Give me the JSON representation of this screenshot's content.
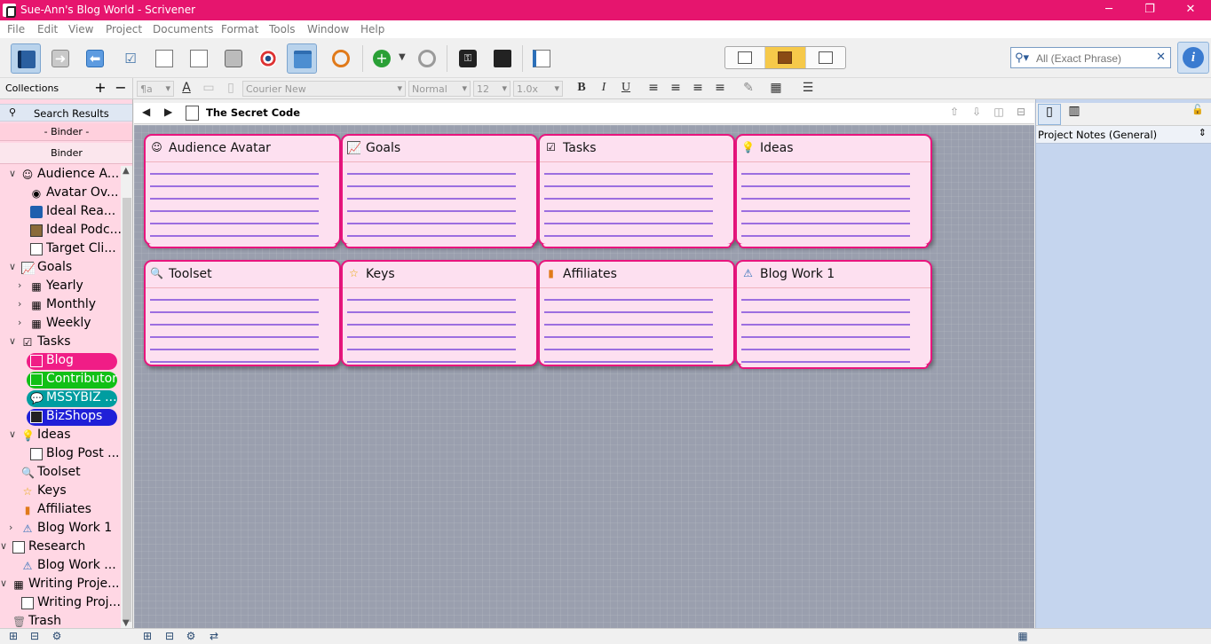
{
  "window": {
    "title": "Sue-Ann's Blog World - Scrivener",
    "minimize": "─",
    "restore": "❐",
    "close": "✕"
  },
  "menu": [
    "File",
    "Edit",
    "View",
    "Project",
    "Documents",
    "Format",
    "Tools",
    "Window",
    "Help"
  ],
  "search": {
    "placeholder": "All (Exact Phrase)",
    "value": ""
  },
  "format": {
    "style": "¶a",
    "font": "Courier New",
    "style_name": "Normal",
    "size": "12",
    "spacing": "1.0x"
  },
  "collections": {
    "label": "Collections",
    "add": "+",
    "remove": "−"
  },
  "sidebar": {
    "search_results": "Search Results",
    "binder_tab": "- Binder -",
    "binder_label": "Binder",
    "items": [
      {
        "label": "Audience A...",
        "icon": "mask-icon"
      },
      {
        "label": "Avatar Ov...",
        "icon": "eye-icon"
      },
      {
        "label": "Ideal Rea...",
        "icon": "book-icon"
      },
      {
        "label": "Ideal Podc...",
        "icon": "picture-icon"
      },
      {
        "label": "Target Cli...",
        "icon": "document-icon"
      },
      {
        "label": "Goals",
        "icon": "chart-icon"
      },
      {
        "label": "Yearly",
        "icon": "grid-icon"
      },
      {
        "label": "Monthly",
        "icon": "grid-icon"
      },
      {
        "label": "Weekly",
        "icon": "grid-icon"
      },
      {
        "label": "Tasks",
        "icon": "checkbox-icon"
      },
      {
        "label": "Blog",
        "icon": "document-icon"
      },
      {
        "label": "Contributor",
        "icon": "document-icon"
      },
      {
        "label": "MSSYBIZ ...",
        "icon": "speech-bubble-icon"
      },
      {
        "label": "BizShops",
        "icon": "terminal-icon"
      },
      {
        "label": "Ideas",
        "icon": "lightbulb-icon"
      },
      {
        "label": "Blog Post ...",
        "icon": "document-icon"
      },
      {
        "label": "Toolset",
        "icon": "magnifier-icon"
      },
      {
        "label": "Keys",
        "icon": "star-icon"
      },
      {
        "label": "Affiliates",
        "icon": "bar-chart-icon"
      },
      {
        "label": "Blog Work 1",
        "icon": "warning-icon"
      },
      {
        "label": "Research",
        "icon": "research-icon"
      },
      {
        "label": "Blog Work ...",
        "icon": "warning-icon"
      },
      {
        "label": "Writing Proje...",
        "icon": "grid-icon"
      },
      {
        "label": "Writing Proj...",
        "icon": "document-icon"
      },
      {
        "label": "Trash",
        "icon": "trash-icon"
      }
    ]
  },
  "editor": {
    "title": "The Secret Code"
  },
  "cards": [
    {
      "title": "Audience Avatar",
      "icon": "mask-icon"
    },
    {
      "title": "Goals",
      "icon": "chart-icon"
    },
    {
      "title": "Tasks",
      "icon": "checkbox-icon"
    },
    {
      "title": "Ideas",
      "icon": "lightbulb-icon"
    },
    {
      "title": "Toolset",
      "icon": "magnifier-icon"
    },
    {
      "title": "Keys",
      "icon": "star-icon"
    },
    {
      "title": "Affiliates",
      "icon": "bar-chart-icon"
    },
    {
      "title": "Blog Work 1",
      "icon": "warning-icon"
    }
  ],
  "inspector": {
    "notes_label": "Project Notes (General)"
  },
  "colors": {
    "titlebar": "#e6156e",
    "card_border": "#e8157d",
    "card_fill": "#fde0f0",
    "cork": "#9a9fae",
    "pill_pink": "#f01d86",
    "pill_green": "#11c016",
    "pill_teal": "#009da0",
    "pill_blue": "#1f1fd8",
    "inspector_bg": "#c5d5ee"
  }
}
